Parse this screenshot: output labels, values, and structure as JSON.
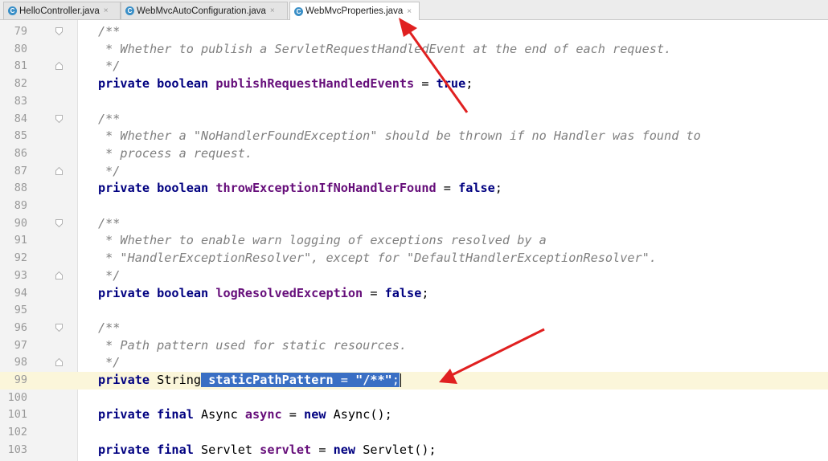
{
  "tabs": [
    {
      "label": "HelloController.java",
      "icon": "class-icon",
      "active": false
    },
    {
      "label": "WebMvcAutoConfiguration.java",
      "icon": "class-icon",
      "active": false
    },
    {
      "label": "WebMvcProperties.java",
      "icon": "class-icon",
      "active": true
    }
  ],
  "tab_icon_letter": "C",
  "tab_close_glyph": "×",
  "editor": {
    "current_line": 99,
    "lines": [
      {
        "n": "79",
        "fold": "open",
        "parts": [
          [
            "cm",
            "/**"
          ]
        ]
      },
      {
        "n": "80",
        "parts": [
          [
            "cm",
            " * Whether to publish a ServletRequestHandledEvent at the end of each request."
          ]
        ]
      },
      {
        "n": "81",
        "fold": "close",
        "parts": [
          [
            "cm",
            " */"
          ]
        ]
      },
      {
        "n": "82",
        "parts": [
          [
            "kw",
            "private boolean "
          ],
          [
            "fld",
            "publishRequestHandledEvents"
          ],
          [
            "",
            " = "
          ],
          [
            "kw",
            "true"
          ],
          [
            "",
            ";"
          ]
        ]
      },
      {
        "n": "83",
        "parts": []
      },
      {
        "n": "84",
        "fold": "open",
        "parts": [
          [
            "cm",
            "/**"
          ]
        ]
      },
      {
        "n": "85",
        "parts": [
          [
            "cm",
            " * Whether a \"NoHandlerFoundException\" should be thrown if no Handler was found to"
          ]
        ]
      },
      {
        "n": "86",
        "parts": [
          [
            "cm",
            " * process a request."
          ]
        ]
      },
      {
        "n": "87",
        "fold": "close",
        "parts": [
          [
            "cm",
            " */"
          ]
        ]
      },
      {
        "n": "88",
        "parts": [
          [
            "kw",
            "private boolean "
          ],
          [
            "fld",
            "throwExceptionIfNoHandlerFound"
          ],
          [
            "",
            " = "
          ],
          [
            "kw",
            "false"
          ],
          [
            "",
            ";"
          ]
        ]
      },
      {
        "n": "89",
        "parts": []
      },
      {
        "n": "90",
        "fold": "open",
        "parts": [
          [
            "cm",
            "/**"
          ]
        ]
      },
      {
        "n": "91",
        "parts": [
          [
            "cm",
            " * Whether to enable warn logging of exceptions resolved by a"
          ]
        ]
      },
      {
        "n": "92",
        "parts": [
          [
            "cm",
            " * \"HandlerExceptionResolver\", except for \"DefaultHandlerExceptionResolver\"."
          ]
        ]
      },
      {
        "n": "93",
        "fold": "close",
        "parts": [
          [
            "cm",
            " */"
          ]
        ]
      },
      {
        "n": "94",
        "parts": [
          [
            "kw",
            "private boolean "
          ],
          [
            "fld",
            "logResolvedException"
          ],
          [
            "",
            " = "
          ],
          [
            "kw",
            "false"
          ],
          [
            "",
            ";"
          ]
        ]
      },
      {
        "n": "95",
        "parts": []
      },
      {
        "n": "96",
        "fold": "open",
        "parts": [
          [
            "cm",
            "/**"
          ]
        ]
      },
      {
        "n": "97",
        "parts": [
          [
            "cm",
            " * Path pattern used for static resources."
          ]
        ]
      },
      {
        "n": "98",
        "fold": "close",
        "parts": [
          [
            "cm",
            " */"
          ]
        ]
      },
      {
        "n": "99",
        "current": true,
        "parts": [
          [
            "kw",
            "private "
          ],
          [
            "",
            "String"
          ],
          [
            "sel",
            " "
          ],
          [
            "sel fld",
            "staticPathPattern"
          ],
          [
            "sel",
            " = "
          ],
          [
            "sel str",
            "\"/**\""
          ],
          [
            "sel",
            ";"
          ],
          [
            "caret",
            ""
          ]
        ]
      },
      {
        "n": "100",
        "parts": []
      },
      {
        "n": "101",
        "parts": [
          [
            "kw",
            "private final "
          ],
          [
            "",
            "Async "
          ],
          [
            "fld",
            "async"
          ],
          [
            "",
            " = "
          ],
          [
            "kw",
            "new "
          ],
          [
            "",
            "Async();"
          ]
        ]
      },
      {
        "n": "102",
        "parts": []
      },
      {
        "n": "103",
        "parts": [
          [
            "kw",
            "private final "
          ],
          [
            "",
            "Servlet "
          ],
          [
            "fld",
            "servlet"
          ],
          [
            "",
            " = "
          ],
          [
            "kw",
            "new "
          ],
          [
            "",
            "Servlet();"
          ]
        ]
      }
    ]
  },
  "colors": {
    "keyword": "#000080",
    "field": "#660e7a",
    "comment": "#808080",
    "string": "#008000",
    "selection": "#3a6fc4",
    "current_line": "#fbf6da",
    "annotation_arrow": "#e02020"
  },
  "annotations": [
    "red-arrow-to-active-tab",
    "red-arrow-to-static-path-pattern"
  ]
}
